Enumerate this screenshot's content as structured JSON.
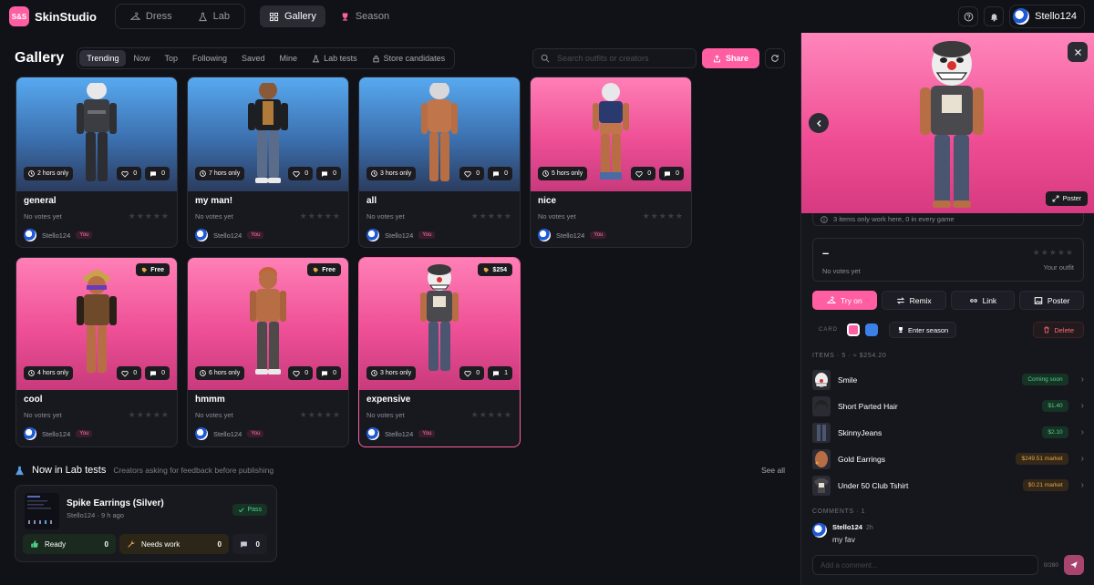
{
  "app": {
    "logo_badge": "S&S",
    "name": "SkinStudio"
  },
  "nav": {
    "dress": "Dress",
    "lab": "Lab",
    "gallery": "Gallery",
    "season": "Season"
  },
  "user": {
    "name": "Stello124"
  },
  "gallery": {
    "title": "Gallery",
    "filters": [
      "Trending",
      "Now",
      "Top",
      "Following",
      "Saved",
      "Mine",
      "Lab tests",
      "Store candidates"
    ],
    "active_filter": "Trending",
    "search_placeholder": "Search outfits or creators",
    "share_label": "Share",
    "cards": [
      {
        "name": "general",
        "time": "2 hors only",
        "likes": "0",
        "comments": "0",
        "votes": "No votes yet",
        "user": "Stello124",
        "you": "You",
        "price": ""
      },
      {
        "name": "my man!",
        "time": "7 hors only",
        "likes": "0",
        "comments": "0",
        "votes": "No votes yet",
        "user": "Stello124",
        "you": "You",
        "price": ""
      },
      {
        "name": "all",
        "time": "3 hors only",
        "likes": "0",
        "comments": "0",
        "votes": "No votes yet",
        "user": "Stello124",
        "you": "You",
        "price": ""
      },
      {
        "name": "nice",
        "time": "5 hors only",
        "likes": "0",
        "comments": "0",
        "votes": "No votes yet",
        "user": "Stello124",
        "you": "You",
        "price": ""
      },
      {
        "name": "cool",
        "time": "4 hors only",
        "likes": "0",
        "comments": "0",
        "votes": "No votes yet",
        "user": "Stello124",
        "you": "You",
        "price": "Free"
      },
      {
        "name": "hmmm",
        "time": "6 hors only",
        "likes": "0",
        "comments": "0",
        "votes": "No votes yet",
        "user": "Stello124",
        "you": "You",
        "price": "Free"
      },
      {
        "name": "expensive",
        "time": "3 hors only",
        "likes": "0",
        "comments": "1",
        "votes": "No votes yet",
        "user": "Stello124",
        "you": "You",
        "price": "$254"
      }
    ]
  },
  "lab": {
    "title": "Now in Lab tests",
    "subtitle": "Creators asking for feedback before publishing",
    "see_all": "See all",
    "card": {
      "name": "Spike Earrings (Silver)",
      "meta": "Stello124 · 9 h ago",
      "status": "Pass",
      "ready_label": "Ready",
      "ready_count": "0",
      "needs_label": "Needs work",
      "needs_count": "0",
      "comments_count": "0"
    }
  },
  "panel": {
    "poster_chip": "Poster",
    "info": "3 items only work here, 0 in every game",
    "outfit_name": "–",
    "no_votes": "No votes yet",
    "your_outfit": "Your outfit",
    "actions": {
      "try_on": "Try on",
      "remix": "Remix",
      "link": "Link",
      "poster": "Poster"
    },
    "card_label": "CARD",
    "enter_season": "Enter season",
    "delete": "Delete",
    "items_header": "ITEMS · 5 · ≈ $254.20",
    "items": [
      {
        "name": "Smile",
        "tag": "Coming soon",
        "tone": "green"
      },
      {
        "name": "Short Parted Hair",
        "tag": "$1.40",
        "tone": "green"
      },
      {
        "name": "SkinnyJeans",
        "tag": "$2.10",
        "tone": "green"
      },
      {
        "name": "Gold Earrings",
        "tag": "$249.51 market",
        "tone": "amber"
      },
      {
        "name": "Under 50 Club Tshirt",
        "tag": "$0.21 market",
        "tone": "amber"
      }
    ],
    "comments_header": "COMMENTS · 1",
    "comment": {
      "author": "Stello124",
      "time": "2h",
      "text": "my fav"
    },
    "comment_placeholder": "Add a comment...",
    "comment_count": "0/280"
  },
  "colors": {
    "accent": "#ff5fa2",
    "pink_bg": "#ef4d93",
    "blue_bg": "#3b6fae",
    "panel_bg": "#16171d"
  }
}
